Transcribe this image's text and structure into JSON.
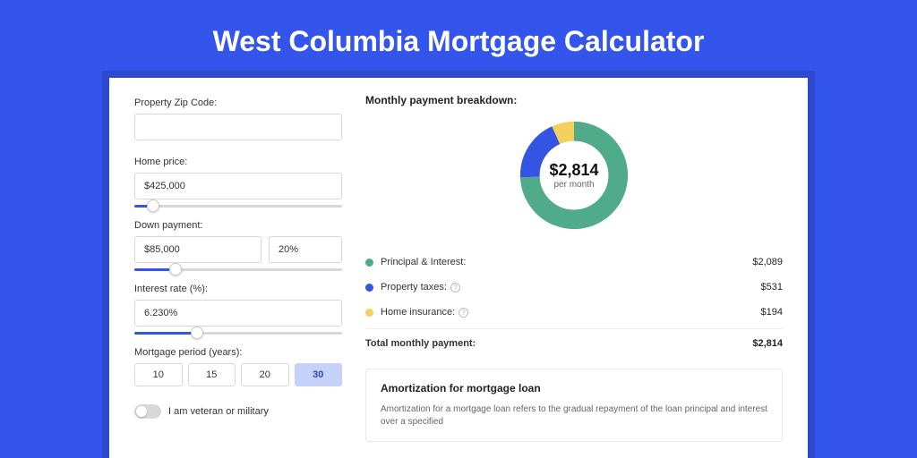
{
  "page": {
    "title": "West Columbia Mortgage Calculator"
  },
  "form": {
    "zip_label": "Property Zip Code:",
    "zip_value": "",
    "home_price_label": "Home price:",
    "home_price_value": "$425,000",
    "home_price_slider_pct": 9,
    "down_payment_label": "Down payment:",
    "down_payment_value": "$85,000",
    "down_payment_pct_value": "20%",
    "down_payment_slider_pct": 20,
    "rate_label": "Interest rate (%):",
    "rate_value": "6.230%",
    "rate_slider_pct": 30,
    "period_label": "Mortgage period (years):",
    "period_options": [
      "10",
      "15",
      "20",
      "30"
    ],
    "period_selected": "30",
    "veteran_label": "I am veteran or military",
    "veteran_on": false
  },
  "breakdown": {
    "title": "Monthly payment breakdown:",
    "center_amount": "$2,814",
    "center_sub": "per month",
    "items": [
      {
        "label": "Principal & Interest:",
        "value": "$2,089",
        "color": "#4fab8a",
        "has_info": false
      },
      {
        "label": "Property taxes:",
        "value": "$531",
        "color": "#3355e2",
        "has_info": true
      },
      {
        "label": "Home insurance:",
        "value": "$194",
        "color": "#f3cf5b",
        "has_info": true
      }
    ],
    "total_label": "Total monthly payment:",
    "total_value": "$2,814"
  },
  "amort": {
    "title": "Amortization for mortgage loan",
    "text": "Amortization for a mortgage loan refers to the gradual repayment of the loan principal and interest over a specified"
  },
  "chart_data": {
    "type": "pie",
    "title": "Monthly payment breakdown",
    "total": 2814,
    "unit": "$ per month",
    "series": [
      {
        "name": "Principal & Interest",
        "value": 2089,
        "color": "#4fab8a"
      },
      {
        "name": "Property taxes",
        "value": 531,
        "color": "#3355e2"
      },
      {
        "name": "Home insurance",
        "value": 194,
        "color": "#f3cf5b"
      }
    ]
  }
}
